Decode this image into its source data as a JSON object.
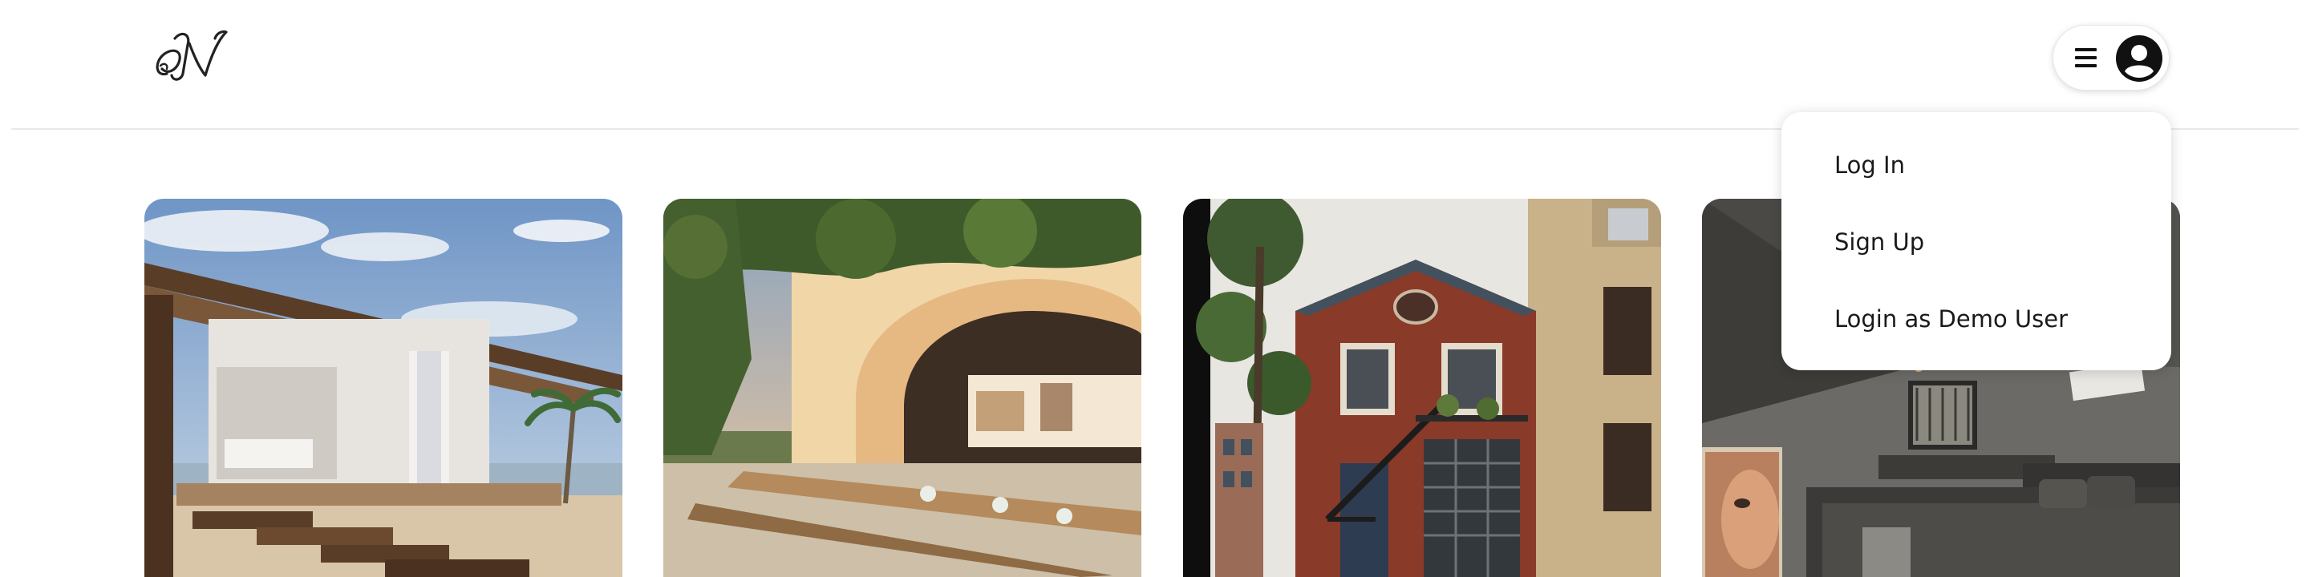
{
  "header": {
    "logo": {
      "text": "N",
      "alt": "brand-logo"
    },
    "menu": {
      "hamburger_icon": "hamburger-menu-icon",
      "avatar_icon": "user-avatar-icon"
    }
  },
  "dropdown": {
    "items": [
      {
        "label": "Log In"
      },
      {
        "label": "Sign Up"
      },
      {
        "label": "Login as Demo User"
      }
    ]
  },
  "listings": [
    {
      "image": "beach-pavilion-photo"
    },
    {
      "image": "arched-terrace-dining-photo"
    },
    {
      "image": "brick-carriage-house-photo"
    },
    {
      "image": "modern-bedroom-photo"
    }
  ]
}
